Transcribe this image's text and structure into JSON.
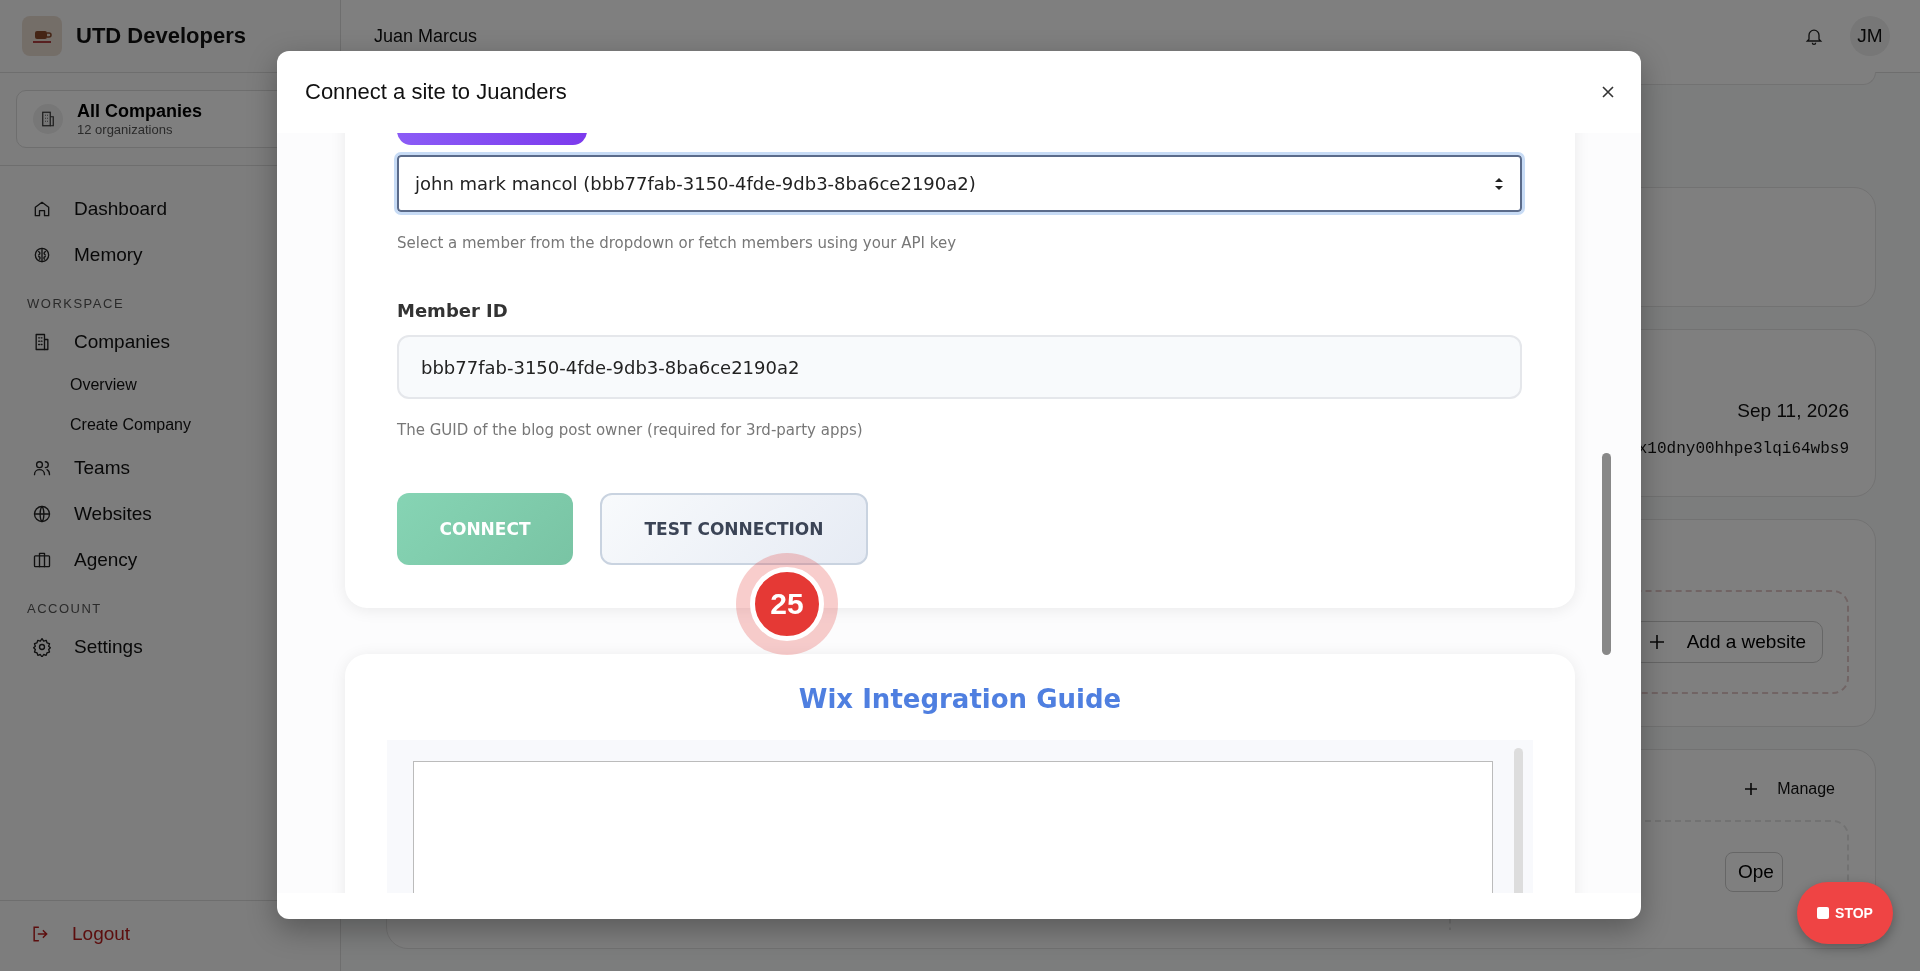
{
  "sidebar": {
    "brand": "UTD Developers",
    "company_switcher": {
      "title": "All Companies",
      "subtitle": "12 organizations"
    },
    "sections": [
      {
        "items": [
          {
            "label": "Dashboard"
          },
          {
            "label": "Memory"
          }
        ]
      },
      {
        "heading": "WORKSPACE",
        "items": [
          {
            "label": "Companies",
            "children": [
              {
                "label": "Overview"
              },
              {
                "label": "Create Company"
              }
            ]
          },
          {
            "label": "Teams"
          },
          {
            "label": "Websites"
          },
          {
            "label": "Agency"
          }
        ]
      },
      {
        "heading": "ACCOUNT",
        "items": [
          {
            "label": "Settings"
          }
        ]
      }
    ],
    "logout": "Logout"
  },
  "header": {
    "user_name": "Juan Marcus",
    "avatar_initials": "JM"
  },
  "background": {
    "date": "Sep 11, 2026",
    "key": "x10dny00hhpe3lqi64wbs9",
    "add_website": "Add a website",
    "manage": "Manage",
    "open": "Ope"
  },
  "modal": {
    "title": "Connect a site to Juanders",
    "member_select": {
      "value": "john mark mancol (bbb77fab-3150-4fde-9db3-8ba6ce2190a2)",
      "help": "Select a member from the dropdown or fetch members using your API key"
    },
    "member_id": {
      "label": "Member ID",
      "value": "bbb77fab-3150-4fde-9db3-8ba6ce2190a2",
      "help": "The GUID of the blog post owner (required for 3rd-party apps)"
    },
    "buttons": [
      {
        "label": "CONNECT",
        "kind": "primary"
      },
      {
        "label": "TEST CONNECTION",
        "kind": "secondary"
      }
    ],
    "guide": {
      "title": "Wix Integration Guide"
    }
  },
  "step_badge": "25",
  "stop_button": "STOP"
}
